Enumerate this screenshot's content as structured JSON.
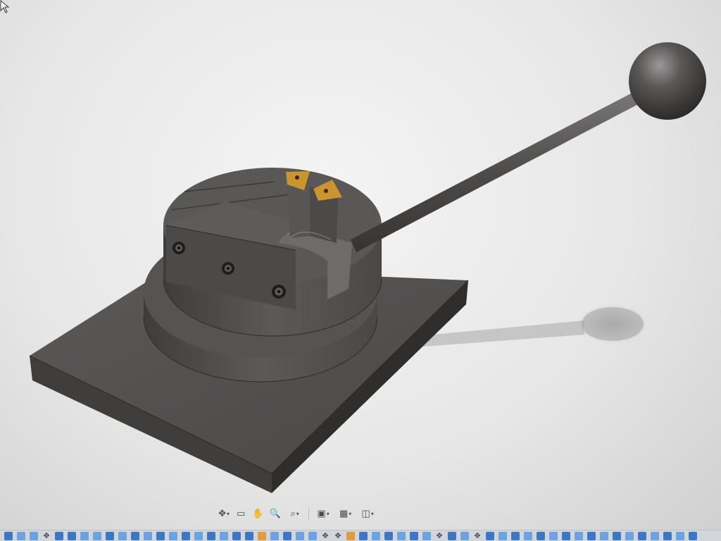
{
  "viewport": {
    "background": "#e9e9e9",
    "model": "bending-jig-assembly",
    "parts": [
      "base-plate",
      "lower-disc",
      "upper-disc",
      "clamp-block",
      "socket-head-screw",
      "screw",
      "screw",
      "die-post",
      "carbide-insert",
      "carbide-insert",
      "lever-rod",
      "ball-knob"
    ]
  },
  "nav_toolbar": {
    "buttons": [
      {
        "name": "orbit-icon",
        "dropdown": true
      },
      {
        "name": "look-at-icon",
        "dropdown": false
      },
      {
        "name": "pan-hand-icon",
        "dropdown": false
      },
      {
        "name": "zoom-icon",
        "dropdown": false
      },
      {
        "name": "fit-zoom-icon",
        "dropdown": true
      },
      {
        "name": "display-settings-icon",
        "dropdown": true
      },
      {
        "name": "grid-icon",
        "dropdown": true
      },
      {
        "name": "viewports-icon",
        "dropdown": true
      }
    ]
  },
  "timeline": {
    "colors": {
      "feature": "#3b78c4",
      "sketch": "#e39a3a",
      "bar": "#d2d5d9"
    }
  },
  "colors": {
    "steel": "#545251",
    "steel_dark": "#3a3938",
    "insert_gold": "#c9952c"
  }
}
